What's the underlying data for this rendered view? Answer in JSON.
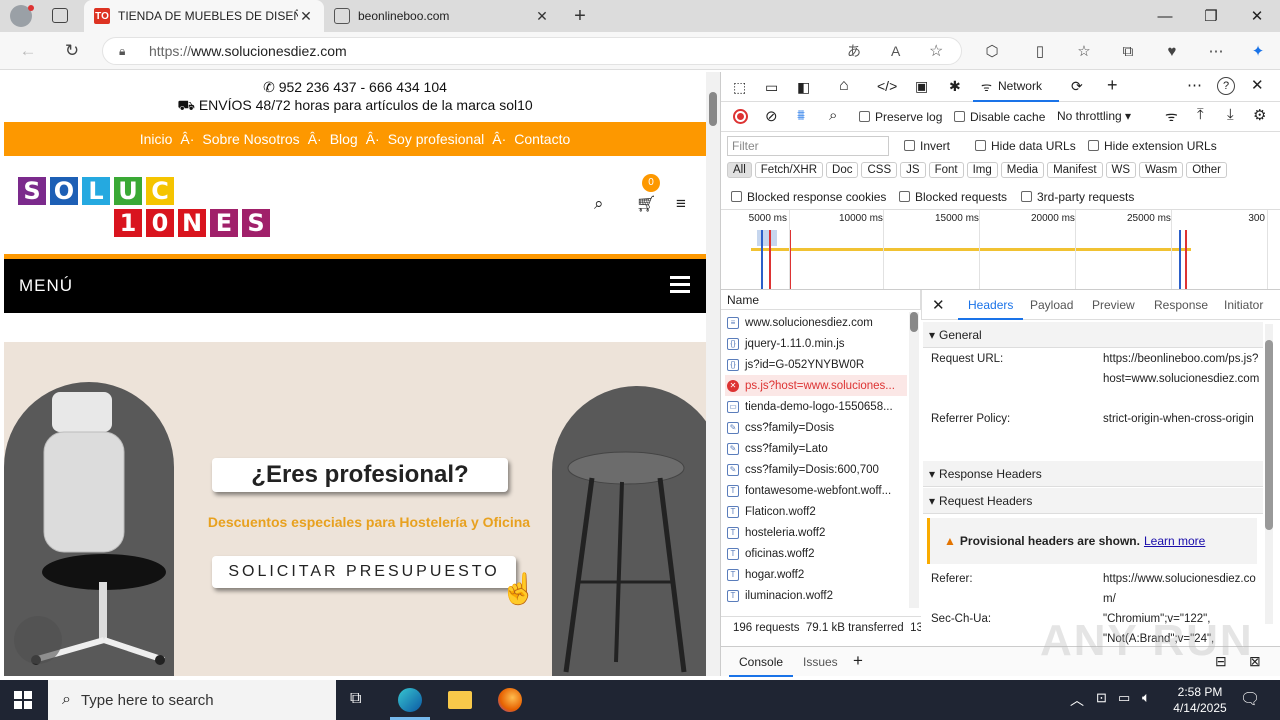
{
  "browser": {
    "tabs": [
      {
        "title": "TIENDA DE MUEBLES DE DISEÑO",
        "favicon": "TO",
        "active": true
      },
      {
        "title": "beonlineboo.com",
        "favicon": "page-icon",
        "active": false
      }
    ],
    "url_prefix": "https://",
    "url_host": "www.solucionesdiez.com"
  },
  "site": {
    "phone": "952 236 437 - 666 434 104",
    "shipping": "ENVÍOS 48/72 horas para artículos de la marca sol10",
    "nav": [
      "Inicio",
      "Sobre Nosotros",
      "Blog",
      "Soy profesional",
      "Contacto"
    ],
    "nav_sep": "Â·",
    "logo_row1": [
      "S",
      "O",
      "L",
      "U",
      "C"
    ],
    "logo_row2": [
      "1",
      "0",
      "N",
      "E",
      "S"
    ],
    "cart_count": "0",
    "menu_label": "MENÚ",
    "hero_title": "¿Eres profesional?",
    "hero_subtitle": "Descuentos especiales para Hostelería y Oficina",
    "hero_button": "SOLICITAR PRESUPUESTO"
  },
  "devtools": {
    "active_tab": "Network",
    "filter_placeholder": "Filter",
    "preserve_log": "Preserve log",
    "disable_cache": "Disable cache",
    "throttling": "No throttling",
    "invert": "Invert",
    "hide_data_urls": "Hide data URLs",
    "hide_ext_urls": "Hide extension URLs",
    "type_filters": [
      "All",
      "Fetch/XHR",
      "Doc",
      "CSS",
      "JS",
      "Font",
      "Img",
      "Media",
      "Manifest",
      "WS",
      "Wasm",
      "Other"
    ],
    "blocked_cookies": "Blocked response cookies",
    "blocked_requests": "Blocked requests",
    "third_party": "3rd-party requests",
    "timeline_ticks": [
      "5000 ms",
      "10000 ms",
      "15000 ms",
      "20000 ms",
      "25000 ms",
      "300"
    ],
    "name_header": "Name",
    "requests": [
      {
        "name": "www.solucionesdiez.com",
        "type": "doc"
      },
      {
        "name": "jquery-1.11.0.min.js",
        "type": "js"
      },
      {
        "name": "js?id=G-052YNYBW0R",
        "type": "js"
      },
      {
        "name": "ps.js?host=www.soluciones...",
        "type": "error"
      },
      {
        "name": "tienda-demo-logo-1550658...",
        "type": "img"
      },
      {
        "name": "css?family=Dosis",
        "type": "css"
      },
      {
        "name": "css?family=Lato",
        "type": "css"
      },
      {
        "name": "css?family=Dosis:600,700",
        "type": "css"
      },
      {
        "name": "fontawesome-webfont.woff...",
        "type": "font"
      },
      {
        "name": "Flaticon.woff2",
        "type": "font"
      },
      {
        "name": "hosteleria.woff2",
        "type": "font"
      },
      {
        "name": "oficinas.woff2",
        "type": "font"
      },
      {
        "name": "hogar.woff2",
        "type": "font"
      },
      {
        "name": "iluminacion.woff2",
        "type": "font"
      }
    ],
    "summary": "196 requests  79.1 kB transferred  13",
    "detail_tabs": [
      "Headers",
      "Payload",
      "Preview",
      "Response",
      "Initiator"
    ],
    "general": "General",
    "request_url_label": "Request URL:",
    "request_url": "https://beonlineboo.com/ps.js?host=www.solucionesdiez.com",
    "referrer_policy_label": "Referrer Policy:",
    "referrer_policy": "strict-origin-when-cross-origin",
    "response_headers": "Response Headers",
    "request_headers": "Request Headers",
    "provisional_note": "Provisional headers are shown.",
    "learn_more": "Learn more",
    "referer_label": "Referer:",
    "referer": "https://www.solucionesdiez.com/",
    "sec_ch_ua_label": "Sec-Ch-Ua:",
    "sec_ch_ua_1": "\"Chromium\";v=\"122\",",
    "sec_ch_ua_2": "\"Not(A:Brand\";v=\"24\",",
    "drawer_tabs": [
      "Console",
      "Issues"
    ]
  },
  "taskbar": {
    "search_placeholder": "Type here to search",
    "time": "2:58 PM",
    "date": "4/14/2025"
  },
  "watermark": "ANY RUN",
  "colors": {
    "orange": "#fd9800",
    "devtools_blue": "#1a73e8",
    "error_red": "#d93025"
  }
}
